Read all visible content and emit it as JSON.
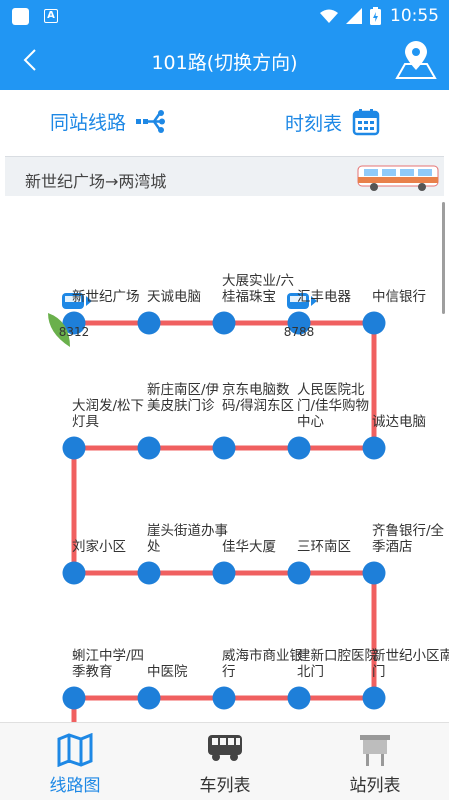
{
  "status": {
    "time": "10:55",
    "notif_badge": "A"
  },
  "header": {
    "title": "101路(切换方向)"
  },
  "actions": {
    "same_station": "同站线路",
    "timetable": "时刻表"
  },
  "direction": "新世纪广场→两湾城",
  "colors": {
    "primary": "#2196f3",
    "route_line": "#f06060",
    "stop": "#1e7fd9",
    "bus_marker_green": "#6ab04c"
  },
  "route": {
    "rows": [
      [
        "新世纪广场",
        "天诚电脑",
        "大展实业/六桂福珠宝",
        "汇丰电器",
        "中信银行"
      ],
      [
        "大润发/松下灯具",
        "伊美皮肤门诊",
        "京东电脑数码/得润东区",
        "人民医院北门/佳华购物中心",
        "诚达电脑"
      ],
      [
        "刘家小区",
        "崖头街道办事处",
        "佳华大厦",
        "三环南区",
        "齐鲁银行/全季酒店"
      ],
      [
        "蜊江中学/四季教育",
        "中医院",
        "威海市商业银行",
        "建新口腔医院北门",
        "新世纪小区南门"
      ]
    ],
    "row1_second_label_top": "新庄南区/",
    "buses": [
      {
        "id": "8312",
        "icon": "bus-icon",
        "at_stop": 0
      },
      {
        "id": "8788",
        "icon": "bus-icon",
        "at_stop": 3
      }
    ]
  },
  "tabs": [
    {
      "label": "线路图",
      "icon": "map-icon",
      "active": true
    },
    {
      "label": "车列表",
      "icon": "bus-icon",
      "active": false
    },
    {
      "label": "站列表",
      "icon": "bus-stop-sign-icon",
      "active": false
    }
  ]
}
